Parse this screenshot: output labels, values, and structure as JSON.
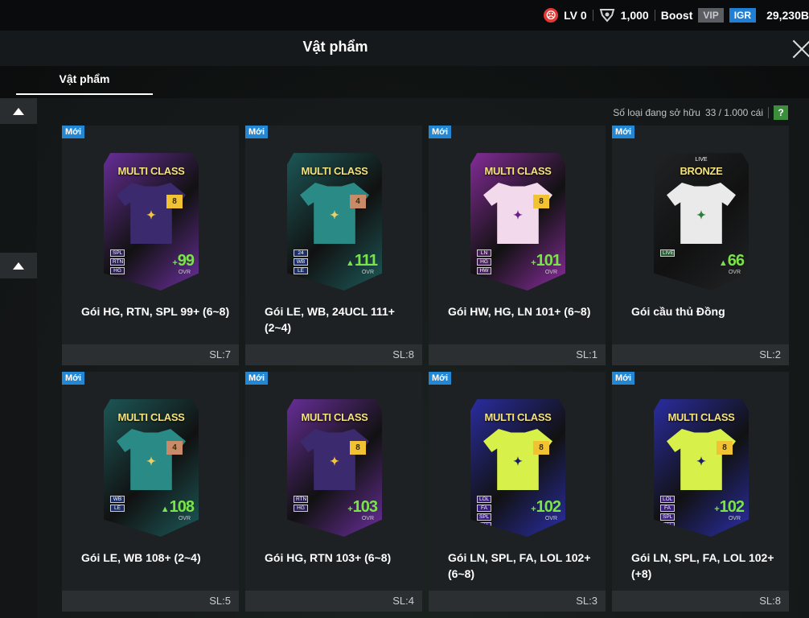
{
  "topbar": {
    "level": "LV 0",
    "currency_amount": "1,000",
    "boost": "Boost",
    "vip": "VIP",
    "igr": "IGR",
    "balance": "29,230B"
  },
  "header": {
    "title": "Vật phẩm"
  },
  "tabs": [
    {
      "label": "Vật phẩm"
    }
  ],
  "inventory": {
    "owned_label": "Số loại đang sở hữu",
    "owned_count": "33 / 1.000 cái",
    "help": "?"
  },
  "items": [
    {
      "badge": "Mới",
      "card_title": "MULTI CLASS",
      "card_sub": "",
      "level": "8",
      "tags": [
        "SPL",
        "RTN",
        "HG"
      ],
      "ovr_prefix": "+",
      "ovr": "99",
      "ovr_label": "OVR",
      "name": "Gói HG, RTN, SPL 99+ (6~8)",
      "qty": "SL:7",
      "bg": "#6b2f9e",
      "shirt": "#3b2a6e",
      "logo": "#f5c542",
      "lvl_bg": "#f1c232",
      "tag_bg": "#2a1d55"
    },
    {
      "badge": "Mới",
      "card_title": "MULTI CLASS",
      "card_sub": "",
      "level": "4",
      "tags": [
        "24",
        "WB",
        "LE"
      ],
      "ovr_prefix": "▲",
      "ovr": "111",
      "ovr_label": "OVR",
      "name": "Gói LE, WB, 24UCL 111+ (2~4)",
      "qty": "SL:8",
      "bg": "#1d5a5a",
      "shirt": "#2a8a86",
      "logo": "#e8d06a",
      "lvl_bg": "#c98a6a",
      "tag_bg": "#1b2e6a"
    },
    {
      "badge": "Mới",
      "card_title": "MULTI CLASS",
      "card_sub": "",
      "level": "8",
      "tags": [
        "LN",
        "HG",
        "HW"
      ],
      "ovr_prefix": "+",
      "ovr": "101",
      "ovr_label": "OVR",
      "name": "Gói HW, HG, LN 101+ (6~8)",
      "qty": "SL:1",
      "bg": "#8a2d9e",
      "shirt": "#f3d9ec",
      "logo": "#6a1f8a",
      "lvl_bg": "#f1c232",
      "tag_bg": "#4a1f5e"
    },
    {
      "badge": "Mới",
      "card_title": "BRONZE",
      "card_sub": "LIVE",
      "level": "",
      "tags": [
        "LIVE"
      ],
      "ovr_prefix": "▲",
      "ovr": "66",
      "ovr_label": "OVR",
      "name": "Gói cầu thủ Đồng",
      "qty": "SL:2",
      "bg": "#202325",
      "shirt": "#eaeaea",
      "logo": "#2f7d3a",
      "lvl_bg": "transparent",
      "tag_bg": "#1f5e2a"
    },
    {
      "badge": "Mới",
      "card_title": "MULTI CLASS",
      "card_sub": "",
      "level": "4",
      "tags": [
        "WB",
        "LE"
      ],
      "ovr_prefix": "▲",
      "ovr": "108",
      "ovr_label": "OVR",
      "name": "Gói LE, WB 108+ (2~4)",
      "qty": "SL:5",
      "bg": "#1d5a5a",
      "shirt": "#2a8a86",
      "logo": "#e8d06a",
      "lvl_bg": "#c98a6a",
      "tag_bg": "#1b2e6a"
    },
    {
      "badge": "Mới",
      "card_title": "MULTI CLASS",
      "card_sub": "",
      "level": "8",
      "tags": [
        "RTN",
        "HG"
      ],
      "ovr_prefix": "+",
      "ovr": "103",
      "ovr_label": "OVR",
      "name": "Gói HG, RTN 103+ (6~8)",
      "qty": "SL:4",
      "bg": "#6b2f9e",
      "shirt": "#3b2a6e",
      "logo": "#f5c542",
      "lvl_bg": "#f1c232",
      "tag_bg": "#2a1d55"
    },
    {
      "badge": "Mới",
      "card_title": "MULTI CLASS",
      "card_sub": "",
      "level": "8",
      "tags": [
        "LOL",
        "FA",
        "SPL",
        "LN"
      ],
      "ovr_prefix": "+",
      "ovr": "102",
      "ovr_label": "OVR",
      "name": "Gói LN, SPL, FA, LOL 102+ (6~8)",
      "qty": "SL:3",
      "bg": "#2b2ea8",
      "shirt": "#d8f04a",
      "logo": "#1a1f6a",
      "lvl_bg": "#f1c232",
      "tag_bg": "#3a1f7a"
    },
    {
      "badge": "Mới",
      "card_title": "MULTI CLASS",
      "card_sub": "",
      "level": "8",
      "tags": [
        "LOL",
        "FA",
        "SPL",
        "LN"
      ],
      "ovr_prefix": "+",
      "ovr": "102",
      "ovr_label": "OVR",
      "name": "Gói LN, SPL, FA, LOL 102+ (+8)",
      "qty": "SL:8",
      "bg": "#2b2ea8",
      "shirt": "#d8f04a",
      "logo": "#1a1f6a",
      "lvl_bg": "#f1c232",
      "tag_bg": "#3a1f7a"
    }
  ]
}
